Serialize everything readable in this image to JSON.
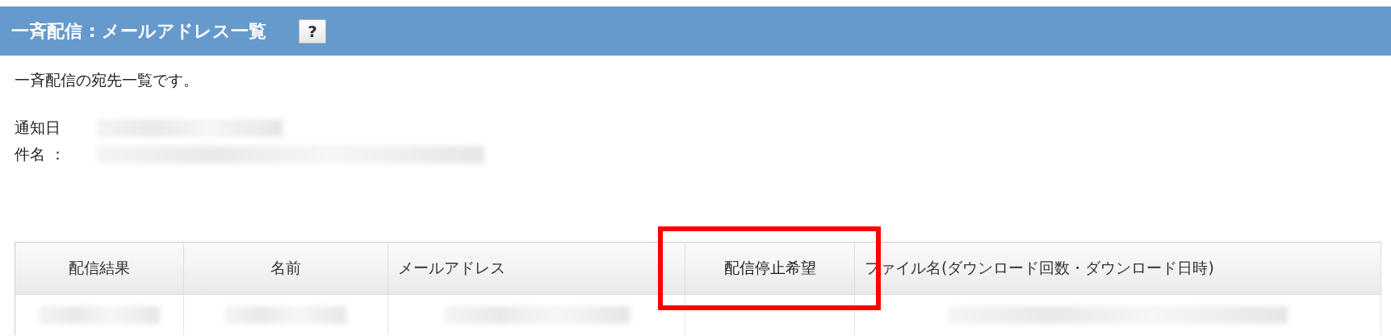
{
  "title_bar": {
    "title": "一斉配信 : メールアドレス一覧",
    "help_button": "?"
  },
  "description": "一斉配信の宛先一覧です。",
  "fields": [
    {
      "label": "通知日"
    },
    {
      "label": "件名 ："
    }
  ],
  "table": {
    "columns": [
      {
        "label": "配信結果",
        "highlighted": false
      },
      {
        "label": "名前",
        "highlighted": false
      },
      {
        "label": "メールアドレス",
        "highlighted": false
      },
      {
        "label": "配信停止希望",
        "highlighted": true
      },
      {
        "label": "ファイル名(ダウンロード回数・ダウンロード日時)",
        "highlighted": false
      }
    ]
  }
}
